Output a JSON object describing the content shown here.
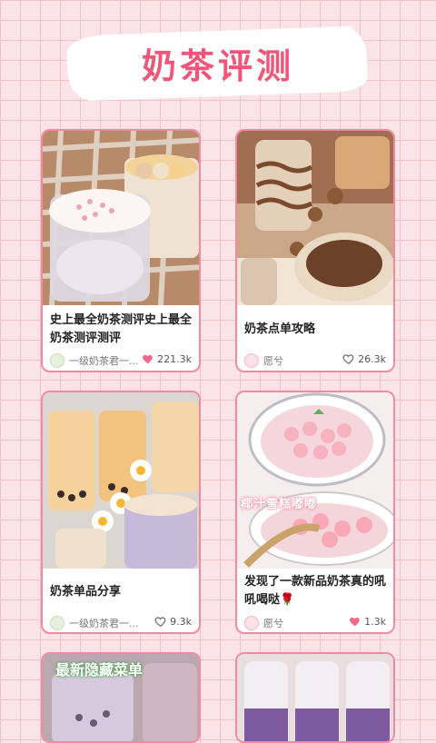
{
  "header": {
    "title": "奶茶评测"
  },
  "cards": [
    {
      "title": "史上最全奶茶测评史上最全奶茶测评测评",
      "author": "一级奶茶君一...",
      "likes": "221.3k",
      "liked": true
    },
    {
      "title": "奶茶点单攻略",
      "author": "愿兮",
      "likes": "26.3k",
      "liked": false
    },
    {
      "title": "奶茶单品分享",
      "author": "一级奶茶君一...",
      "likes": "9.3k",
      "liked": false
    },
    {
      "title": "发现了一款新品奶茶真的吼吼喝哒🌹",
      "author": "愿兮",
      "likes": "1.3k",
      "liked": true
    },
    {
      "title": "",
      "author": "",
      "likes": "",
      "liked": false,
      "overlay_text": "最新隐藏菜单"
    },
    {
      "title": "",
      "author": "",
      "likes": "",
      "liked": false
    }
  ],
  "overlay": {
    "coconut_text": "椰汁雪糕嘟嘟"
  },
  "icons": {
    "like": "heart-icon",
    "avatar": "avatar-icon"
  },
  "colors": {
    "accent": "#f0557a",
    "card_border": "#f48aa1",
    "heart_filled": "#f06a8a"
  }
}
